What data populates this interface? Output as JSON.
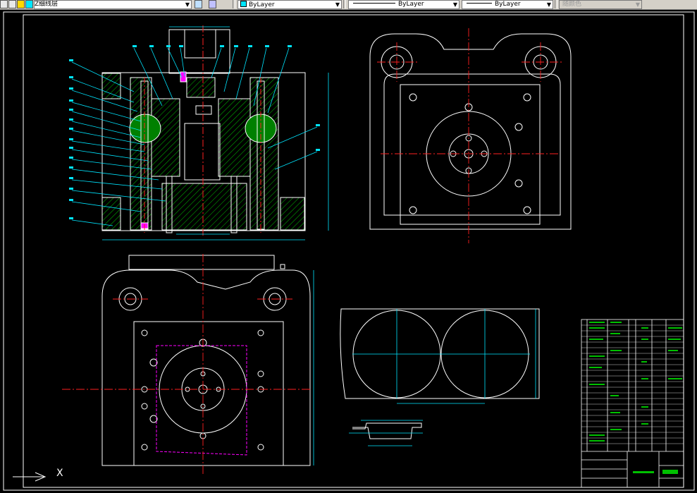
{
  "toolbar": {
    "layer_name": "Z细线层",
    "color": "ByLayer",
    "linetype": "ByLayer",
    "lineweight": "ByLayer",
    "plotstyle": "随颜色",
    "dropdown_arrow": "▼"
  },
  "canvas": {
    "ucs_x_label": "X"
  },
  "colors": {
    "background": "#000000",
    "outline": "#ffffff",
    "centerline": "#ff2020",
    "dimension": "#00e5ff",
    "hatch": "#00c000",
    "leader": "#00e5ff",
    "blank_outline": "#ff00ff"
  }
}
